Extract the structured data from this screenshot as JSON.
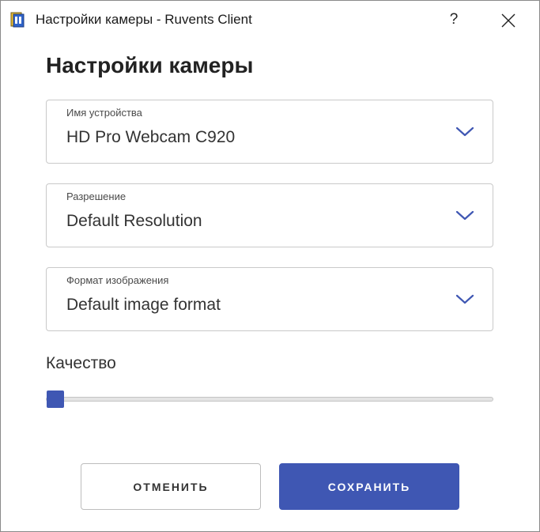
{
  "window": {
    "title": "Настройки камеры - Ruvents Client",
    "help_label": "?"
  },
  "heading": "Настройки камеры",
  "fields": [
    {
      "label": "Имя устройства",
      "value": "HD Pro Webcam C920",
      "icon": "chevron-down-icon"
    },
    {
      "label": "Разрешение",
      "value": "Default Resolution",
      "icon": "chevron-down-icon"
    },
    {
      "label": "Формат изображения",
      "value": "Default image format",
      "icon": "chevron-down-icon"
    }
  ],
  "quality": {
    "label": "Качество",
    "value_fraction": 0.0
  },
  "buttons": {
    "cancel_label": "ОТМЕНИТЬ",
    "save_label": "СОХРАНИТЬ"
  },
  "colors": {
    "accent": "#3f57b3",
    "text": "#333333",
    "border": "#c9c9c9"
  }
}
